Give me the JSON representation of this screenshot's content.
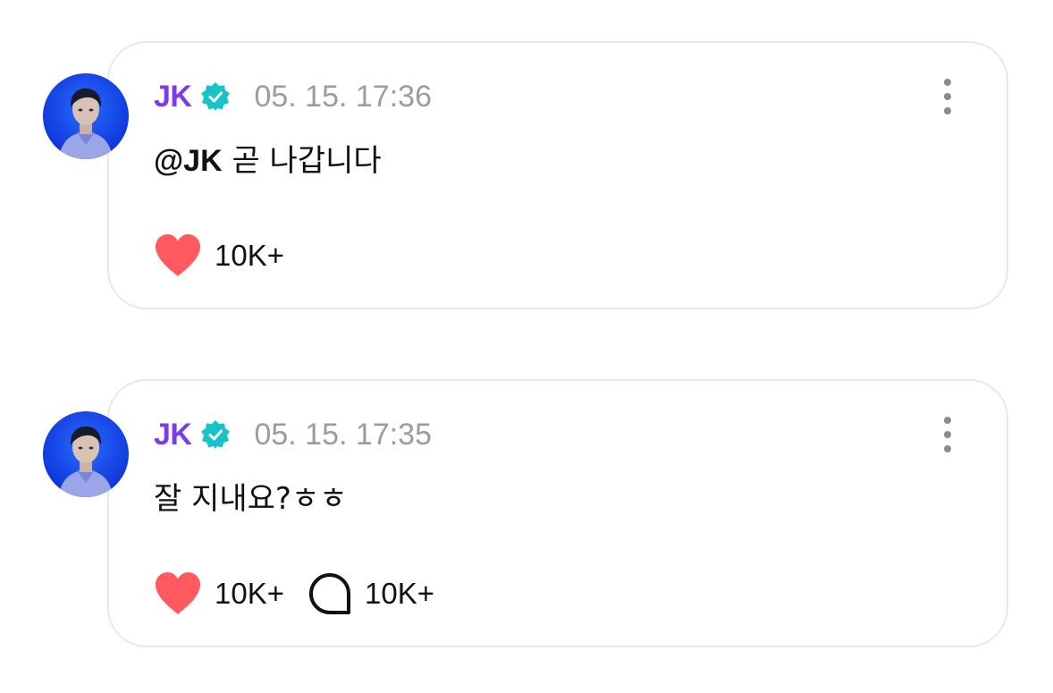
{
  "posts": [
    {
      "author": "JK",
      "timestamp": "05. 15. 17:36",
      "mention": "@JK",
      "text": "곧 나갑니다",
      "likes": "10K+"
    },
    {
      "author": "JK",
      "timestamp": "05. 15. 17:35",
      "text": "잘 지내요?ㅎㅎ",
      "likes": "10K+",
      "comments": "10K+"
    }
  ],
  "icons": {
    "verified": "verified-badge-icon",
    "more": "more-vertical-icon",
    "like": "heart-icon",
    "comment": "comment-bubble-icon"
  },
  "colors": {
    "author": "#7c3aed",
    "verified": "#17c3c9",
    "heart": "#ff5a5f",
    "timestamp": "#9b9ba3",
    "card_border": "#e8e8ec"
  }
}
